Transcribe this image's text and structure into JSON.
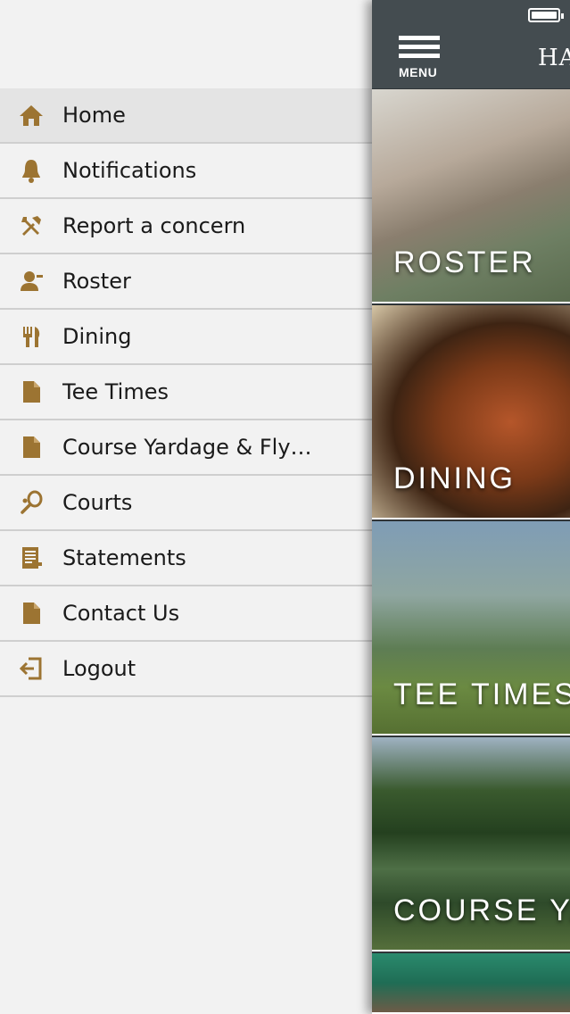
{
  "drawer": {
    "items": [
      {
        "label": "Home",
        "icon": "home-icon",
        "active": true
      },
      {
        "label": "Notifications",
        "icon": "bell-icon",
        "active": false
      },
      {
        "label": "Report a concern",
        "icon": "tools-icon",
        "active": false
      },
      {
        "label": "Roster",
        "icon": "person-icon",
        "active": false
      },
      {
        "label": "Dining",
        "icon": "fork-knife-icon",
        "active": false
      },
      {
        "label": "Tee Times",
        "icon": "document-icon",
        "active": false
      },
      {
        "label": "Course Yardage & Fly…",
        "icon": "document-icon",
        "active": false
      },
      {
        "label": "Courts",
        "icon": "tennis-racket-icon",
        "active": false
      },
      {
        "label": "Statements",
        "icon": "statement-icon",
        "active": false
      },
      {
        "label": "Contact Us",
        "icon": "document-icon",
        "active": false
      },
      {
        "label": "Logout",
        "icon": "logout-icon",
        "active": false
      }
    ]
  },
  "main": {
    "menu_label": "MENU",
    "brand": "HA",
    "tiles": [
      {
        "label": "ROSTER"
      },
      {
        "label": "DINING"
      },
      {
        "label": "TEE TIMES"
      },
      {
        "label": "COURSE YA"
      },
      {
        "label": ""
      }
    ]
  },
  "colors": {
    "accent": "#9c7432",
    "topbar": "#444c50"
  }
}
